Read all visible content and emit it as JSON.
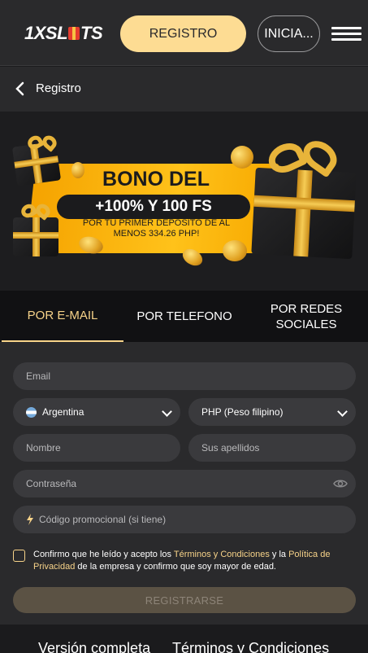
{
  "header": {
    "logo_pre": "1XSL",
    "logo_post": "TS",
    "register_label": "REGISTRO",
    "login_label": "INICIA..."
  },
  "subheader": {
    "title": "Registro"
  },
  "banner": {
    "title": "BONO DEL",
    "highlight": "+100% Y 100 FS",
    "description": "POR TU PRIMER DEPÓSITO DE AL MENOS 334.26 PHP!"
  },
  "tabs": [
    {
      "label": "POR E-MAIL",
      "active": true
    },
    {
      "label": "POR TELEFONO",
      "active": false
    },
    {
      "label": "POR REDES SOCIALES",
      "active": false
    }
  ],
  "form": {
    "email_placeholder": "Email",
    "country_value": "Argentina",
    "currency_value": "PHP (Peso filipino)",
    "name_placeholder": "Nombre",
    "surname_placeholder": "Sus apellidos",
    "password_placeholder": "Contraseña",
    "promo_placeholder": "Código promocional (si tiene)",
    "terms": {
      "part1": "Confirmo que he leído y acepto los ",
      "link1": "Términos y Condiciones",
      "part2": " y la ",
      "link2": "Política de Privacidad",
      "part3": " de la empresa y confirmo que soy mayor de edad."
    },
    "submit_label": "REGISTRARSE"
  },
  "footer": {
    "links": [
      "Versión completa",
      "Términos y Condiciones"
    ]
  },
  "colors": {
    "accent": "#fddc93",
    "tab_active": "#f7d389",
    "background": "#2a2a2c",
    "banner_yellow": "#ffc21a"
  },
  "icons": [
    "chevron-left-icon",
    "hamburger-icon",
    "flag-argentina-icon",
    "chevron-down-icon",
    "eye-icon",
    "bolt-icon"
  ]
}
